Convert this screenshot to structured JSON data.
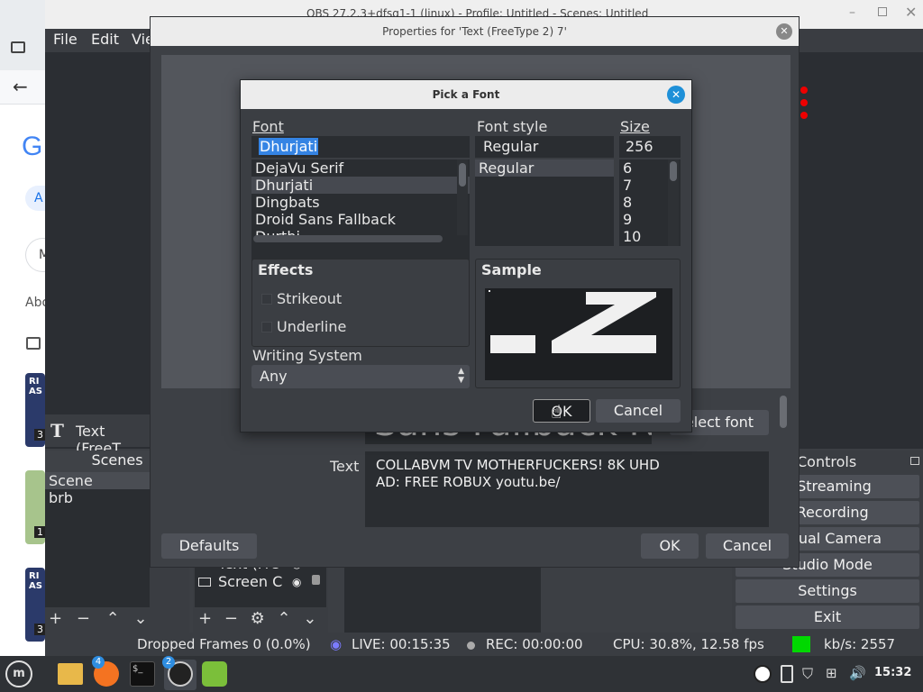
{
  "obs": {
    "window_title": "OBS 27.2.3+dfsg1-1 (linux) - Profile: Untitled - Scenes: Untitled",
    "menu": [
      "File",
      "Edit",
      "Vie"
    ],
    "source_toolbar_label": "Text (FreeT",
    "select_font_button": "elect font",
    "preview_bg_text": "Sans Fallback Re",
    "docks": {
      "scenes_title": "Scenes",
      "scenes": [
        "Scene",
        "brb"
      ],
      "sources": [
        "Text (Fre",
        "Screen C"
      ],
      "controls_title": "Controls",
      "controls": [
        "o Streaming",
        "t Recording",
        "Virtual Camera",
        "Studio Mode",
        "Settings",
        "Exit"
      ]
    },
    "statusbar": {
      "dropped": "Dropped Frames 0 (0.0%)",
      "live": "LIVE: 00:15:35",
      "rec": "REC: 00:00:00",
      "cpu": "CPU: 30.8%, 12.58 fps",
      "kbs": "kb/s: 2557",
      "status_color": "#00d800"
    }
  },
  "properties": {
    "title": "Properties for 'Text (FreeType 2) 7'",
    "text_label": "Text",
    "text_value": "COLLABVM TV MOTHERFUCKERS! 8K UHD\nAD: FREE ROBUX youtu.be/",
    "defaults_button": "Defaults",
    "ok_button": "OK",
    "cancel_button": "Cancel"
  },
  "font_dialog": {
    "title": "Pick a Font",
    "font_label": "Font",
    "font_value": "Dhurjati",
    "fonts": [
      "DejaVu Serif",
      "Dhurjati",
      "Dingbats",
      "Droid Sans Fallback",
      "Durthi"
    ],
    "selected_font": "Dhurjati",
    "style_label": "Font style",
    "style_value": "Regular",
    "styles": [
      "Regular"
    ],
    "size_label": "Size",
    "size_value": "256",
    "sizes": [
      "6",
      "7",
      "8",
      "9",
      "10"
    ],
    "effects_label": "Effects",
    "strikeout_label": "Strikeout",
    "underline_label": "Underline",
    "writing_system_label": "Writing System",
    "writing_system_value": "Any",
    "sample_label": "Sample",
    "ok_button": "OK",
    "cancel_button": "Cancel"
  },
  "browser": {
    "partial_texts": [
      "G",
      "A",
      "M",
      "Abo",
      "RI AS",
      "3",
      "1",
      "RI AS",
      "3"
    ]
  },
  "taskbar": {
    "clock": "15:32",
    "badges": [
      "4",
      "2"
    ]
  }
}
